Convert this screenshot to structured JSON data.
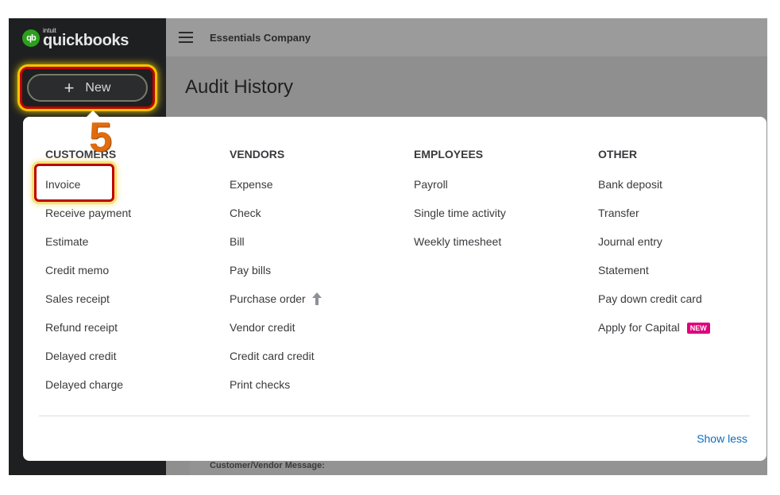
{
  "logo": {
    "badge": "qb",
    "small": "intuit",
    "main": "quickbooks"
  },
  "sidebar": {
    "new_button": {
      "icon": "plus-icon",
      "label": "New"
    }
  },
  "topbar": {
    "menu_icon": "hamburger-icon",
    "company": "Essentials Company"
  },
  "page": {
    "title": "Audit History",
    "customer_vendor_message": "Customer/Vendor Message:"
  },
  "annotation": {
    "step": "5",
    "color": "#e06c10"
  },
  "menu": {
    "customers": {
      "heading": "CUSTOMERS",
      "items": [
        "Invoice",
        "Receive payment",
        "Estimate",
        "Credit memo",
        "Sales receipt",
        "Refund receipt",
        "Delayed credit",
        "Delayed charge"
      ]
    },
    "vendors": {
      "heading": "VENDORS",
      "items": [
        "Expense",
        "Check",
        "Bill",
        "Pay bills",
        "Purchase order",
        "Vendor credit",
        "Credit card credit",
        "Print checks"
      ],
      "purchase_order_icon": "upgrade-arrow-icon"
    },
    "employees": {
      "heading": "EMPLOYEES",
      "items": [
        "Payroll",
        "Single time activity",
        "Weekly timesheet"
      ]
    },
    "other": {
      "heading": "OTHER",
      "items": [
        "Bank deposit",
        "Transfer",
        "Journal entry",
        "Statement",
        "Pay down credit card",
        "Apply for Capital"
      ],
      "new_badge": "NEW"
    },
    "show_less": "Show less"
  },
  "colors": {
    "brand_green": "#2ca01c",
    "link_blue": "#0b6dbc",
    "badge_pink": "#e0007a",
    "highlight_red": "#c00000"
  }
}
